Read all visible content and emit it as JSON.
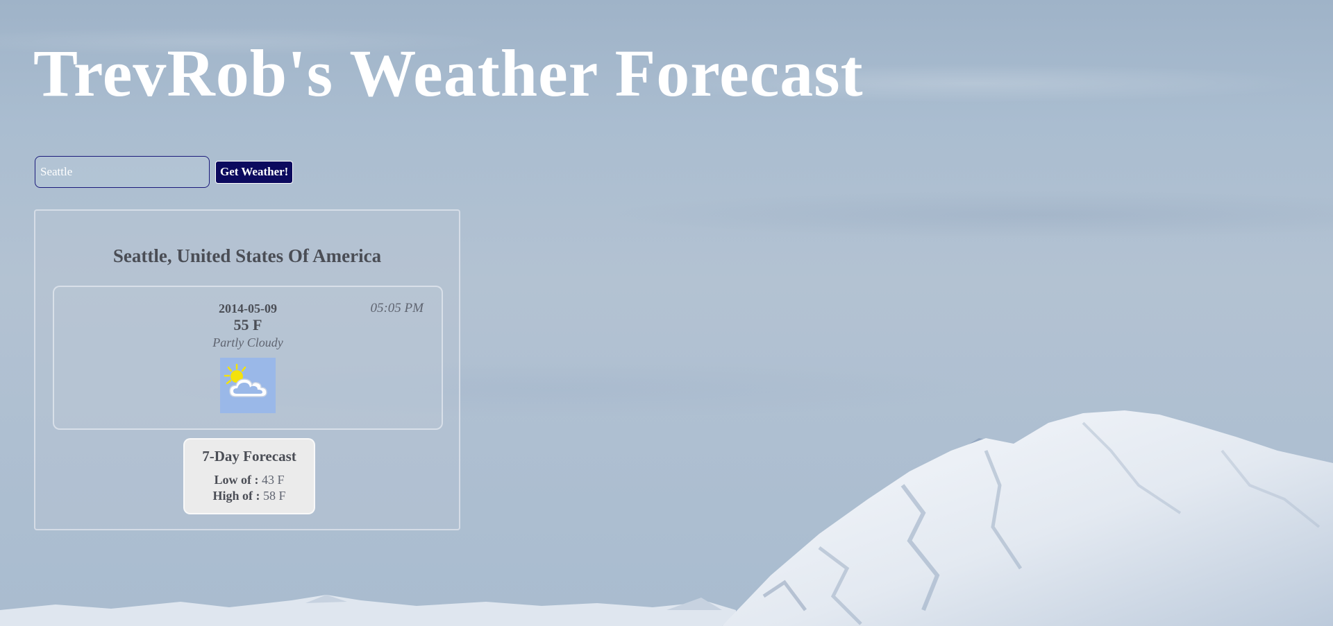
{
  "site": {
    "title": "TrevRob's Weather Forecast"
  },
  "search": {
    "value": "Seattle",
    "button_label": "Get Weather!"
  },
  "result": {
    "location": "Seattle, United States Of America",
    "current": {
      "date": "2014-05-09",
      "time": "05:05 PM",
      "temperature": "55 F",
      "condition": "Partly Cloudy",
      "icon": "partly-cloudy-icon"
    },
    "forecast": {
      "title": "7-Day Forecast",
      "low_label": "Low of :",
      "low_value": "43 F",
      "high_label": "High of :",
      "high_value": "58 F"
    }
  },
  "colors": {
    "accent_button": "#0c0a5e",
    "title_text": "#ffffff",
    "icon_background": "#9ab8e8",
    "sun": "#f4e20c"
  }
}
